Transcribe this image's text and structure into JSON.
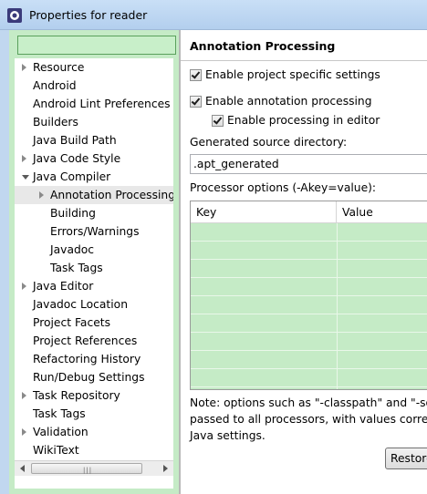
{
  "window": {
    "title": "Properties for reader",
    "icon": "eclipse-properties-icon"
  },
  "sidebar": {
    "filter_value": "",
    "items": [
      {
        "label": "Resource",
        "level": 0,
        "expander": "collapsed"
      },
      {
        "label": "Android",
        "level": 0,
        "expander": "none"
      },
      {
        "label": "Android Lint Preferences",
        "level": 0,
        "expander": "none"
      },
      {
        "label": "Builders",
        "level": 0,
        "expander": "none"
      },
      {
        "label": "Java Build Path",
        "level": 0,
        "expander": "none"
      },
      {
        "label": "Java Code Style",
        "level": 0,
        "expander": "collapsed"
      },
      {
        "label": "Java Compiler",
        "level": 0,
        "expander": "expanded"
      },
      {
        "label": "Annotation Processing",
        "level": 1,
        "expander": "collapsed",
        "selected": true
      },
      {
        "label": "Building",
        "level": 1,
        "expander": "none"
      },
      {
        "label": "Errors/Warnings",
        "level": 1,
        "expander": "none"
      },
      {
        "label": "Javadoc",
        "level": 1,
        "expander": "none"
      },
      {
        "label": "Task Tags",
        "level": 1,
        "expander": "none"
      },
      {
        "label": "Java Editor",
        "level": 0,
        "expander": "collapsed"
      },
      {
        "label": "Javadoc Location",
        "level": 0,
        "expander": "none"
      },
      {
        "label": "Project Facets",
        "level": 0,
        "expander": "none"
      },
      {
        "label": "Project References",
        "level": 0,
        "expander": "none"
      },
      {
        "label": "Refactoring History",
        "level": 0,
        "expander": "none"
      },
      {
        "label": "Run/Debug Settings",
        "level": 0,
        "expander": "none"
      },
      {
        "label": "Task Repository",
        "level": 0,
        "expander": "collapsed"
      },
      {
        "label": "Task Tags",
        "level": 0,
        "expander": "none"
      },
      {
        "label": "Validation",
        "level": 0,
        "expander": "collapsed"
      },
      {
        "label": "WikiText",
        "level": 0,
        "expander": "none"
      }
    ]
  },
  "main": {
    "page_title": "Annotation Processing",
    "enable_project_specific": {
      "label": "Enable project specific settings",
      "checked": true
    },
    "enable_annotation_processing": {
      "label": "Enable annotation processing",
      "checked": true
    },
    "enable_processing_in_editor": {
      "label": "Enable processing in editor",
      "checked": true
    },
    "generated_dir_label": "Generated source directory:",
    "generated_dir_value": ".apt_generated",
    "processor_options_label": "Processor options (-Akey=value):",
    "table": {
      "columns": [
        "Key",
        "Value"
      ],
      "rows": []
    },
    "note_lines": [
      "Note: options such as \"-classpath\" and \"-sou",
      "passed to all processors, with values corresp",
      "Java settings."
    ],
    "restore_label": "Restore"
  },
  "colors": {
    "tree_background": "#c5ebc6",
    "title_bar": "#c9dff6"
  }
}
